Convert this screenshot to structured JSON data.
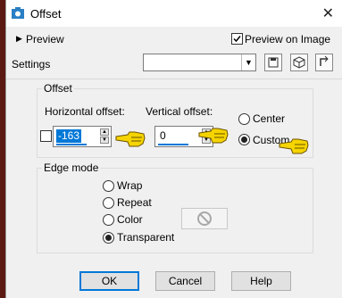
{
  "window": {
    "title": "Offset",
    "close_icon": "✕"
  },
  "toolbar": {
    "preview_label": "Preview",
    "preview_on_image_label": "Preview on Image",
    "preview_on_image_checked": true,
    "settings_label": "Settings",
    "settings_value": ""
  },
  "offset": {
    "group_label": "Offset",
    "horizontal_label": "Horizontal offset:",
    "horizontal_value": "-163",
    "vertical_label": "Vertical offset:",
    "vertical_value": "0",
    "center_label": "Center",
    "custom_label": "Custom",
    "custom_selected": true
  },
  "edge_mode": {
    "group_label": "Edge mode",
    "options": [
      "Wrap",
      "Repeat",
      "Color",
      "Transparent"
    ],
    "selected": "Transparent"
  },
  "buttons": {
    "ok": "OK",
    "cancel": "Cancel",
    "help": "Help"
  },
  "colors": {
    "hand": "#f5d400",
    "dialog_bg": "#f0f0f0",
    "background": "#5a1a12"
  }
}
